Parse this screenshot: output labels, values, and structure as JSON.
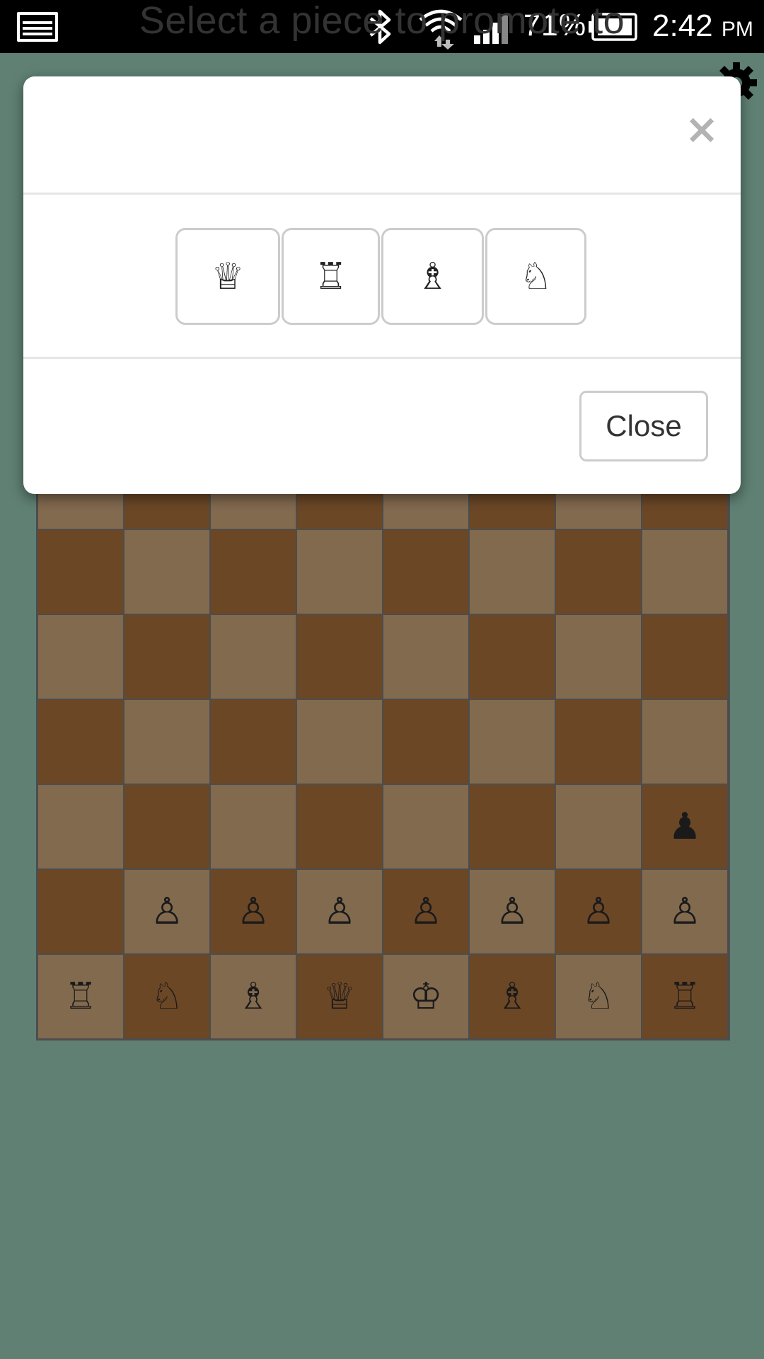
{
  "status_bar": {
    "battery_percent": "71%",
    "time": "2:42",
    "ampm": "PM",
    "icons": [
      "gallery-icon",
      "bluetooth-icon",
      "wifi-icon",
      "signal-icon",
      "battery-icon"
    ]
  },
  "settings": {
    "icon": "gear-icon"
  },
  "board": {
    "colors": {
      "light": "#826a4f",
      "dark": "#6b4726",
      "border": "#4d4d4d"
    },
    "ranks": [
      [
        "",
        "",
        "",
        "",
        "",
        "",
        "",
        ""
      ],
      [
        "",
        "",
        "",
        "",
        "",
        "",
        "",
        ""
      ],
      [
        "",
        "",
        "",
        "",
        "",
        "",
        "",
        ""
      ],
      [
        "",
        "",
        "",
        "",
        "",
        "",
        "",
        ""
      ],
      [
        "",
        "",
        "",
        "",
        "",
        "",
        "",
        ""
      ],
      [
        "",
        "",
        "",
        "",
        "",
        "",
        "",
        "♟"
      ],
      [
        "",
        "♙",
        "♙",
        "♙",
        "♙",
        "♙",
        "♙",
        "♙"
      ],
      [
        "♖",
        "♘",
        "♗",
        "♕",
        "♔",
        "♗",
        "♘",
        "♖"
      ]
    ],
    "piece_names": {
      "♟": "black-pawn",
      "♙": "white-pawn",
      "♖": "white-rook",
      "♘": "white-knight",
      "♗": "white-bishop",
      "♕": "white-queen",
      "♔": "white-king"
    }
  },
  "modal": {
    "title": "Select a piece to promote to",
    "close_x": "×",
    "options": [
      {
        "piece": "queen",
        "glyph": "♕"
      },
      {
        "piece": "rook",
        "glyph": "♖"
      },
      {
        "piece": "bishop",
        "glyph": "♗"
      },
      {
        "piece": "knight",
        "glyph": "♘"
      }
    ],
    "close_label": "Close"
  },
  "colors": {
    "background": "#5f8073",
    "status_bar": "#000000",
    "modal_bg": "#ffffff",
    "option_border": "#cccccc"
  }
}
